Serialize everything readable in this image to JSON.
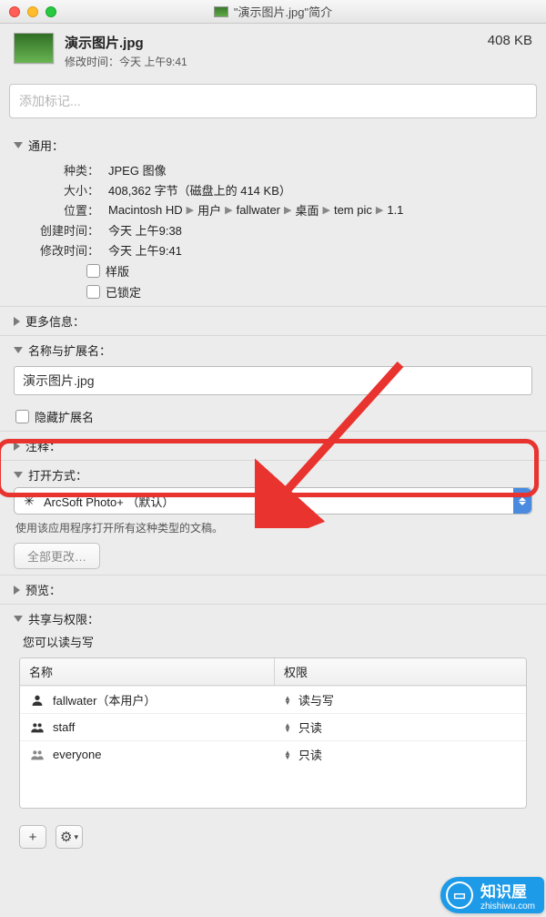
{
  "titlebar": {
    "title": "\"演示图片.jpg\"简介"
  },
  "header": {
    "filename": "演示图片.jpg",
    "modified_label": "修改时间：",
    "modified_value": "今天 上午9:41",
    "size": "408 KB"
  },
  "tags": {
    "placeholder": "添加标记..."
  },
  "general": {
    "title": "通用：",
    "kind_label": "种类：",
    "kind": "JPEG 图像",
    "size_label": "大小：",
    "size": "408,362 字节（磁盘上的 414 KB）",
    "where_label": "位置：",
    "path": [
      "Macintosh HD",
      "用户",
      "fallwater",
      "桌面",
      "tem pic",
      "1.1"
    ],
    "created_label": "创建时间：",
    "created": "今天 上午9:38",
    "modified_label": "修改时间：",
    "modified": "今天 上午9:41",
    "stationery": "样版",
    "locked": "已锁定"
  },
  "more_info": {
    "title": "更多信息："
  },
  "name_ext": {
    "title": "名称与扩展名：",
    "value": "演示图片.jpg",
    "hide_ext": "隐藏扩展名"
  },
  "comments": {
    "title": "注释："
  },
  "open_with": {
    "title": "打开方式：",
    "selected": "ArcSoft Photo+ （默认）",
    "help": "使用该应用程序打开所有这种类型的文稿。",
    "change_all": "全部更改…"
  },
  "preview": {
    "title": "预览："
  },
  "sharing": {
    "title": "共享与权限：",
    "you_can": "您可以读与写",
    "col_name": "名称",
    "col_priv": "权限",
    "rows": [
      {
        "name": "fallwater（本用户）",
        "priv": "读与写",
        "icon": "user"
      },
      {
        "name": "staff",
        "priv": "只读",
        "icon": "group"
      },
      {
        "name": "everyone",
        "priv": "只读",
        "icon": "group"
      }
    ]
  },
  "watermark": {
    "brand": "知识屋",
    "url": "zhishiwu.com"
  }
}
